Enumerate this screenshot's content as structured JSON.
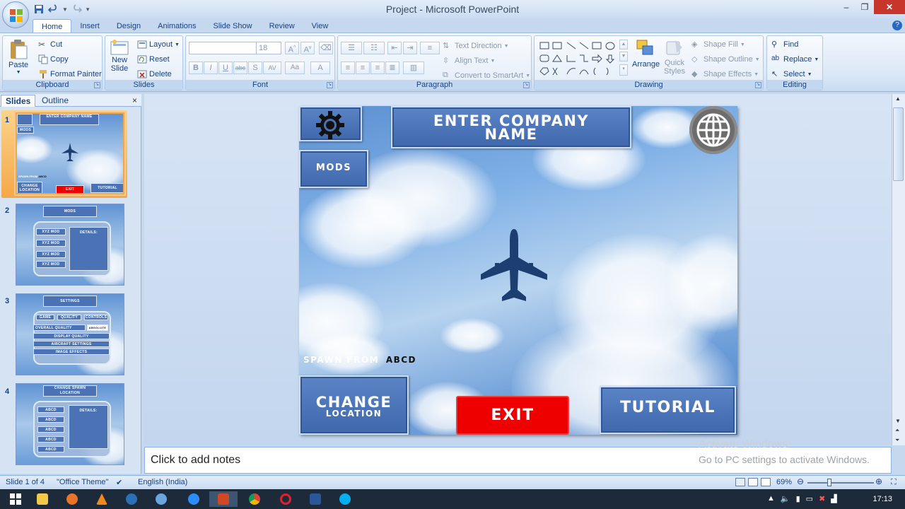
{
  "window": {
    "title": "Project - Microsoft PowerPoint",
    "minimize": "–",
    "restore": "❐",
    "close": "✕"
  },
  "tabs": [
    "Home",
    "Insert",
    "Design",
    "Animations",
    "Slide Show",
    "Review",
    "View"
  ],
  "active_tab": "Home",
  "ribbon": {
    "clipboard": {
      "label": "Clipboard",
      "paste": "Paste",
      "cut": "Cut",
      "copy": "Copy",
      "format_painter": "Format Painter"
    },
    "slides": {
      "label": "Slides",
      "new_slide_1": "New",
      "new_slide_2": "Slide",
      "layout": "Layout",
      "reset": "Reset",
      "delete": "Delete"
    },
    "font": {
      "label": "Font",
      "font_name": "",
      "font_size": "18"
    },
    "paragraph": {
      "label": "Paragraph",
      "text_direction": "Text Direction",
      "align_text": "Align Text",
      "convert_smartart": "Convert to SmartArt"
    },
    "drawing": {
      "label": "Drawing",
      "arrange": "Arrange",
      "quick_styles_1": "Quick",
      "quick_styles_2": "Styles",
      "shape_fill": "Shape Fill",
      "shape_outline": "Shape Outline",
      "shape_effects": "Shape Effects"
    },
    "editing": {
      "label": "Editing",
      "find": "Find",
      "replace": "Replace",
      "select": "Select"
    }
  },
  "panel": {
    "tab_slides": "Slides",
    "tab_outline": "Outline",
    "close": "×"
  },
  "thumbnails": [
    {
      "num": "1",
      "title": "ENTER COMPANY NAME",
      "mods": "MODS",
      "spawn": "SPAWN FROM",
      "spawn_val": "ABCD",
      "change": "CHANGE",
      "location": "LOCATION",
      "exit": "EXIT",
      "tutorial": "TUTORIAL"
    },
    {
      "num": "2",
      "title": "MODS",
      "items": [
        "XYZ MOD",
        "XYZ MOD",
        "XYZ MOD",
        "XYZ MOD"
      ],
      "details": "DETAILS:"
    },
    {
      "num": "3",
      "title": "SETTINGS",
      "tabs": [
        "GAME",
        "QUALITY",
        "CONTROLS"
      ],
      "overall": "OVERALL QUALITY",
      "overall_val": "ABSOLUTE",
      "rows": [
        "DISPLAY QUALITY",
        "AIRCRAFT SETTINGS",
        "IMAGE EFFECTS"
      ]
    },
    {
      "num": "4",
      "title": "CHANGE SPAWN LOCATION",
      "items": [
        "ABCD",
        "ABCD",
        "ABCD",
        "ABCD",
        "ABCD"
      ],
      "details": "DETAILS:"
    }
  ],
  "slide": {
    "company_line1": "ENTER COMPANY",
    "company_line2": "NAME",
    "mods": "MODS",
    "spawn_label": "SPAWN FROM",
    "spawn_value": "ABCD",
    "change": "CHANGE",
    "location": "LOCATION",
    "exit": "EXIT",
    "tutorial": "TUTORIAL",
    "colors": {
      "button_blue": "#4a72b5",
      "exit_red": "#ee0000"
    }
  },
  "notes": {
    "placeholder": "Click to add notes"
  },
  "watermark": {
    "line1": "Activate Windows",
    "line2": "Go to PC settings to activate Windows."
  },
  "status": {
    "slide": "Slide 1 of 4",
    "theme": "\"Office Theme\"",
    "language": "English (India)",
    "zoom": "69%"
  },
  "taskbar": {
    "time": "17:13"
  }
}
